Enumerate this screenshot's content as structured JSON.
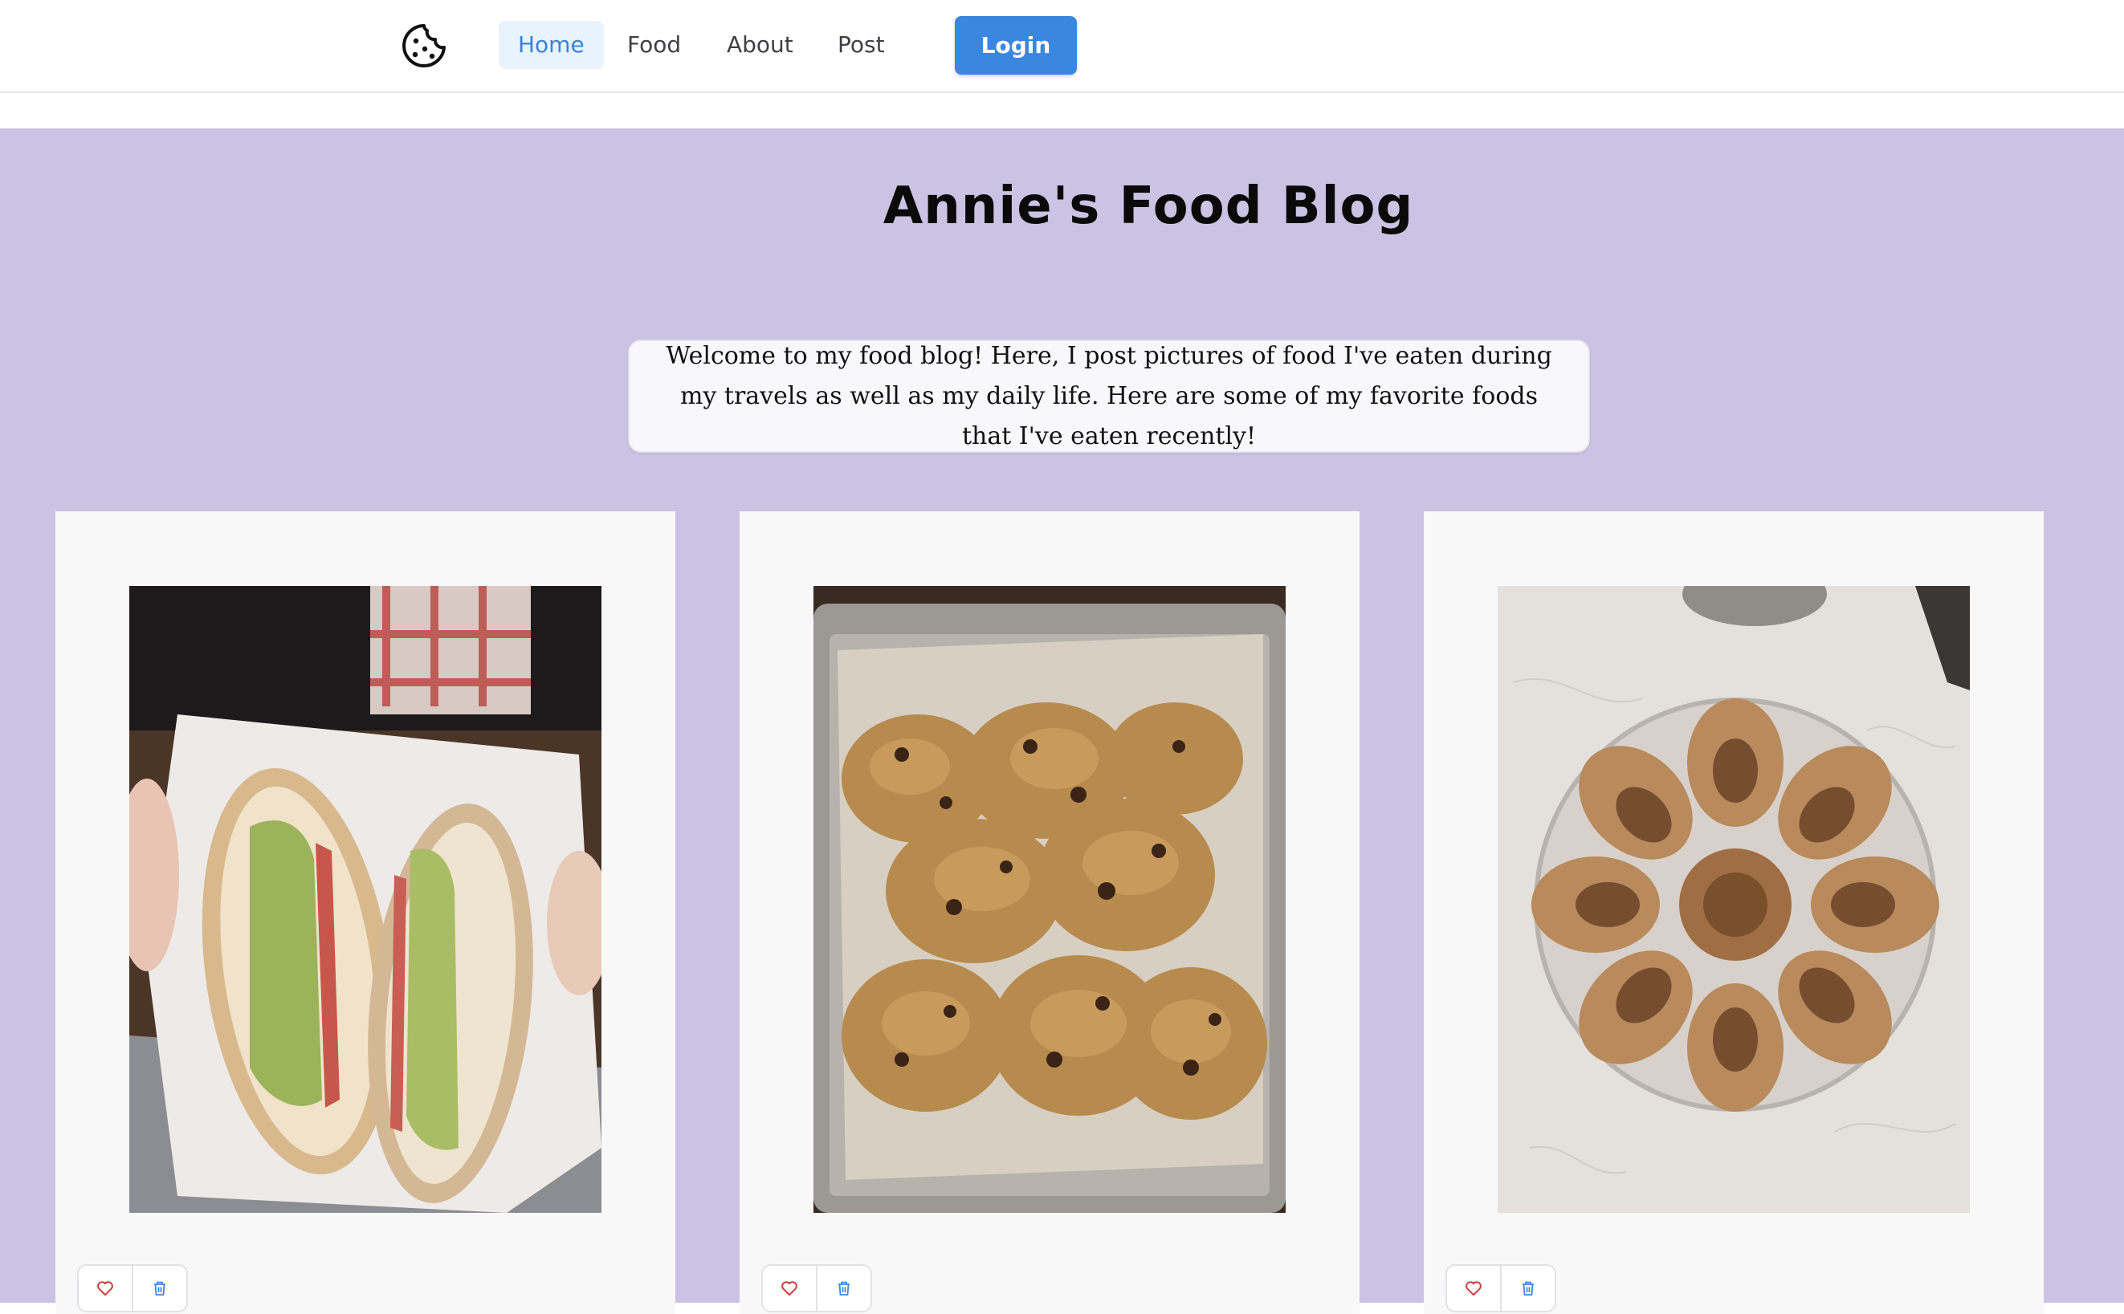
{
  "nav": {
    "logo_icon": "cookie-icon",
    "items": [
      {
        "label": "Home",
        "active": true
      },
      {
        "label": "Food",
        "active": false
      },
      {
        "label": "About",
        "active": false
      },
      {
        "label": "Post",
        "active": false
      }
    ],
    "login_label": "Login"
  },
  "hero": {
    "title": "Annie's Food Blog",
    "welcome_text": "Welcome to my food blog! Here, I post pictures of food I've eaten during my travels as well as my daily life. Here are some of my favorite foods that I've eaten recently!"
  },
  "cards": [
    {
      "photo_icon": "sandwich-photo",
      "like_icon": "heart-icon",
      "delete_icon": "trash-icon"
    },
    {
      "photo_icon": "cookies-photo",
      "like_icon": "heart-icon",
      "delete_icon": "trash-icon"
    },
    {
      "photo_icon": "dumplings-photo",
      "like_icon": "heart-icon",
      "delete_icon": "trash-icon"
    }
  ],
  "colors": {
    "content_background": "#cac3e3",
    "login_button": "#3b87e0",
    "active_nav_text": "#3a83d6",
    "active_nav_background": "#e8f3fc",
    "card_background": "#f8f8f8",
    "heart_icon": "#d23b3b",
    "trash_icon": "#3b87e0"
  }
}
